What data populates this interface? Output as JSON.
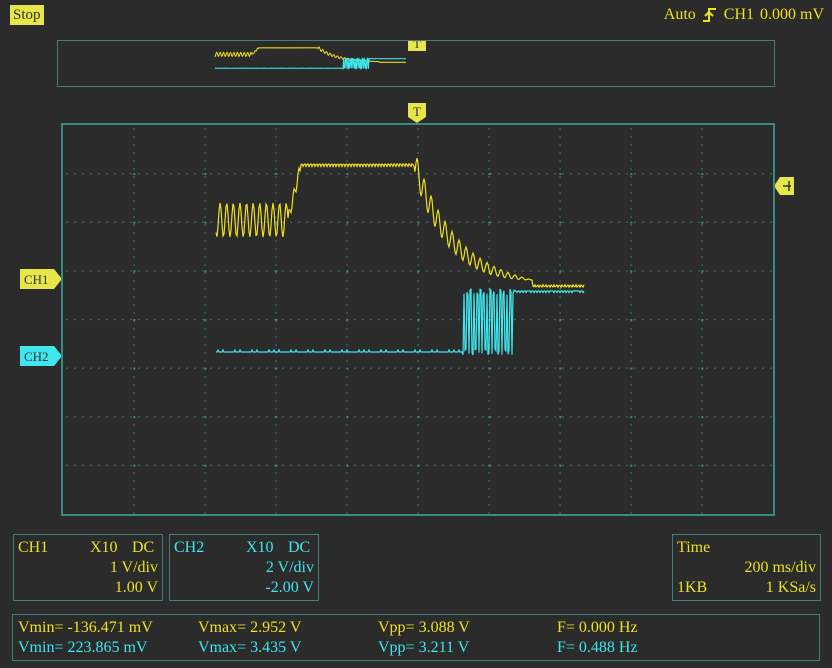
{
  "status": {
    "run_state": "Stop"
  },
  "trigger": {
    "mode": "Auto",
    "source": "CH1",
    "level": "0.000 mV"
  },
  "markers": {
    "trigger_top": "T",
    "ch1": "CH1",
    "ch2": "CH2"
  },
  "ch1_panel": {
    "name": "CH1",
    "probe": "X10",
    "coupling": "DC",
    "scale": "1 V/div",
    "offset": "1.00 V"
  },
  "ch2_panel": {
    "name": "CH2",
    "probe": "X10",
    "coupling": "DC",
    "scale": "2 V/div",
    "offset": "-2.00 V"
  },
  "time_panel": {
    "title": "Time",
    "timebase": "200 ms/div",
    "memory": "1KB",
    "sample_rate": "1 KSa/s"
  },
  "measurements": {
    "ch1": {
      "vmin": "Vmin= -136.471 mV",
      "vmax": "Vmax= 2.952 V",
      "vpp": "Vpp= 3.088 V",
      "freq": "F= 0.000 Hz"
    },
    "ch2": {
      "vmin": "Vmin= 223.865 mV",
      "vmax": "Vmax= 3.435 V",
      "vpp": "Vpp= 3.211 V",
      "freq": "F= 0.488 Hz"
    }
  },
  "colors": {
    "ch1": "#f0e020",
    "ch2": "#3ee7ee",
    "grid": "#3a8a84",
    "background": "#2b2b2b"
  }
}
